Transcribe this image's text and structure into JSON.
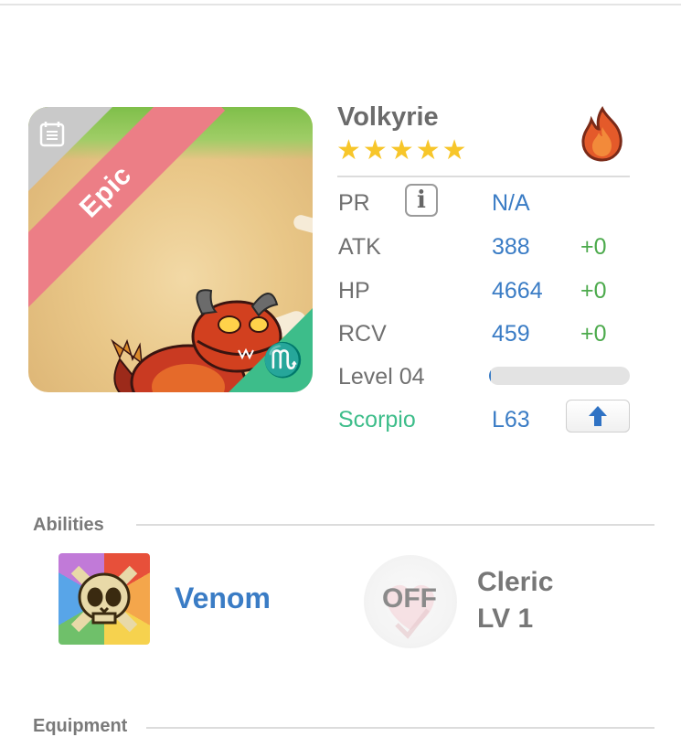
{
  "monster": {
    "rarity": "Epic",
    "name": "Volkyrie",
    "stars": 5,
    "element_icon": "fire-icon",
    "zodiac_icon": "scorpio-icon",
    "portrait_icon": "dragon-portrait"
  },
  "stats": {
    "pr": {
      "label": "PR",
      "value": "N/A"
    },
    "atk": {
      "label": "ATK",
      "value": "388",
      "bonus": "+0"
    },
    "hp": {
      "label": "HP",
      "value": "4664",
      "bonus": "+0"
    },
    "rcv": {
      "label": "RCV",
      "value": "459",
      "bonus": "+0"
    },
    "level": {
      "label": "Level 04",
      "progress_fraction": 0.01
    },
    "zodiac": {
      "label": "Scorpio",
      "value": "L63"
    }
  },
  "sections": {
    "abilities": "Abilities",
    "equipment": "Equipment"
  },
  "abilities": {
    "primary": {
      "name": "Venom",
      "icon": "skull-icon"
    },
    "secondary": {
      "status": "OFF",
      "name": "Cleric",
      "level": "LV 1",
      "icon": "heart-icon"
    }
  },
  "colors": {
    "accent_blue": "#3a7cc5",
    "bonus_green": "#4caa4c",
    "zodiac_green": "#3dbd8a",
    "epic_ribbon": "#ec7e86",
    "star": "#f7c62a"
  }
}
